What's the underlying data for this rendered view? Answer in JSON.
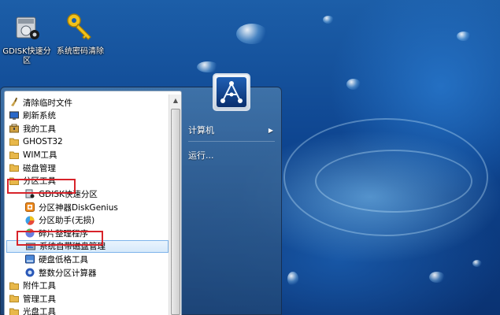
{
  "desktop": {
    "icons": [
      {
        "label": "GDISK快速分区",
        "icon": "disk-gear-icon"
      },
      {
        "label": "系统密码清除",
        "icon": "key-icon"
      }
    ]
  },
  "start_menu": {
    "programs": [
      {
        "label": "清除临时文件",
        "icon": "broom-icon"
      },
      {
        "label": "刷新系统",
        "icon": "monitor-icon"
      },
      {
        "label": "我的工具",
        "icon": "toolbox-icon"
      },
      {
        "label": "GHOST32",
        "icon": "folder-icon"
      },
      {
        "label": "WIM工具",
        "icon": "folder-icon"
      },
      {
        "label": "磁盘管理",
        "icon": "folder-icon"
      },
      {
        "label": "分区工具",
        "icon": "folder-icon"
      },
      {
        "label": "GDISK快速分区",
        "icon": "disk-gear-icon"
      },
      {
        "label": "分区神器DiskGenius",
        "icon": "diskgenius-icon"
      },
      {
        "label": "分区助手(无损)",
        "icon": "partition-assistant-icon"
      },
      {
        "label": "碎片整理程序",
        "icon": "defrag-icon"
      },
      {
        "label": "系统自带磁盘管理",
        "icon": "disk-management-icon"
      },
      {
        "label": "硬盘低格工具",
        "icon": "hdd-icon"
      },
      {
        "label": "整数分区计算器",
        "icon": "calculator-icon"
      },
      {
        "label": "附件工具",
        "icon": "folder-icon"
      },
      {
        "label": "管理工具",
        "icon": "folder-icon"
      },
      {
        "label": "光盘工具",
        "icon": "folder-icon"
      }
    ],
    "selected": "系统自带磁盘管理",
    "right_pane": {
      "computer": "计算机",
      "run": "运行..."
    }
  },
  "colors": {
    "highlight_red": "#d8232a",
    "selection_border": "#7eb4ea",
    "folder": "#e8b84a"
  }
}
